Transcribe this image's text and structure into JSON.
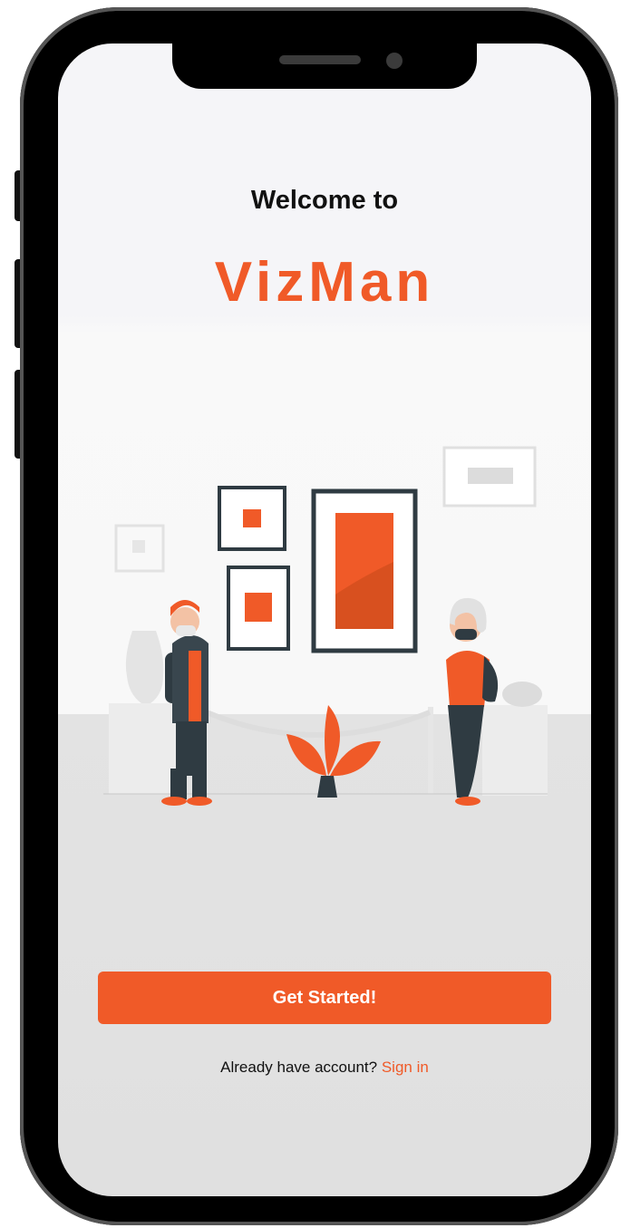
{
  "welcome": {
    "title": "Welcome to"
  },
  "brand": {
    "name": "VizMan"
  },
  "actions": {
    "get_started_label": "Get Started!"
  },
  "signin": {
    "prompt": "Already have account?",
    "link_label": "Sign in"
  },
  "colors": {
    "accent": "#f05a28",
    "dark": "#2f3b42",
    "background": "#f5f5f8"
  }
}
